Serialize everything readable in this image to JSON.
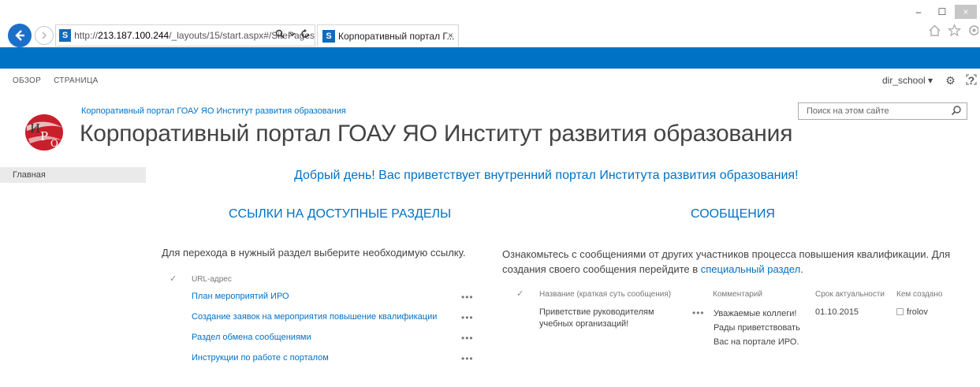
{
  "browser": {
    "url_prefix": "http://",
    "url_host": "213.187.100.244",
    "url_path": "/_layouts/15/start.aspx#/SitePages",
    "tab_title": "Корпоративный портал Г...",
    "tab_close": "×",
    "win_minimize": "–",
    "win_restore": "☐",
    "win_close": "×"
  },
  "suite": {
    "user": "dir_school ▾",
    "settings": "⚙",
    "help": "?"
  },
  "ribbon": {
    "tabs": [
      "ОБЗОР",
      "СТРАНИЦА"
    ]
  },
  "site": {
    "breadcrumb": "Корпоративный портал ГОАУ ЯО Институт развития образования",
    "title": "Корпоративный портал ГОАУ ЯО Институт развития образования",
    "search_placeholder": "Поиск на этом сайте"
  },
  "leftnav": {
    "items": [
      "Главная"
    ]
  },
  "content": {
    "welcome": "Добрый день! Вас приветствует внутренний портал Института развития образования!",
    "links_heading": "ССЫЛКИ НА ДОСТУПНЫЕ РАЗДЕЛЫ",
    "messages_heading": "СООБЩЕНИЯ",
    "links_desc": "Для перехода в нужный раздел выберите необходимую ссылку.",
    "links_column": "URL-адрес",
    "links": [
      "План мероприятий ИРО",
      "Создание заявок на мероприятия повышение квалификации",
      "Раздел обмена сообщениями",
      "Инструкции по работе с порталом"
    ],
    "ellipsis": "•••",
    "check": "✓",
    "msgs_desc": "Ознакомьтесь с сообщениями от других участников процесса повышения квалификации. Для создания своего сообщения перейдите в ",
    "msgs_link": "специальный раздел",
    "msgs_desc_end": ".",
    "msg_columns": [
      "Название (краткая суть сообщения)",
      "Комментарий",
      "Срок актуальности",
      "Кем создано"
    ],
    "messages": [
      {
        "title": "Приветствие руководителям учебных организаций!",
        "comment": "Уважаемые коллеги! Рады приветствовать Вас на портале ИРО.",
        "due": "01.10.2015",
        "author": "frolov"
      }
    ]
  },
  "colors": {
    "accent": "#0072c6",
    "suitebar": "#0072c6"
  }
}
